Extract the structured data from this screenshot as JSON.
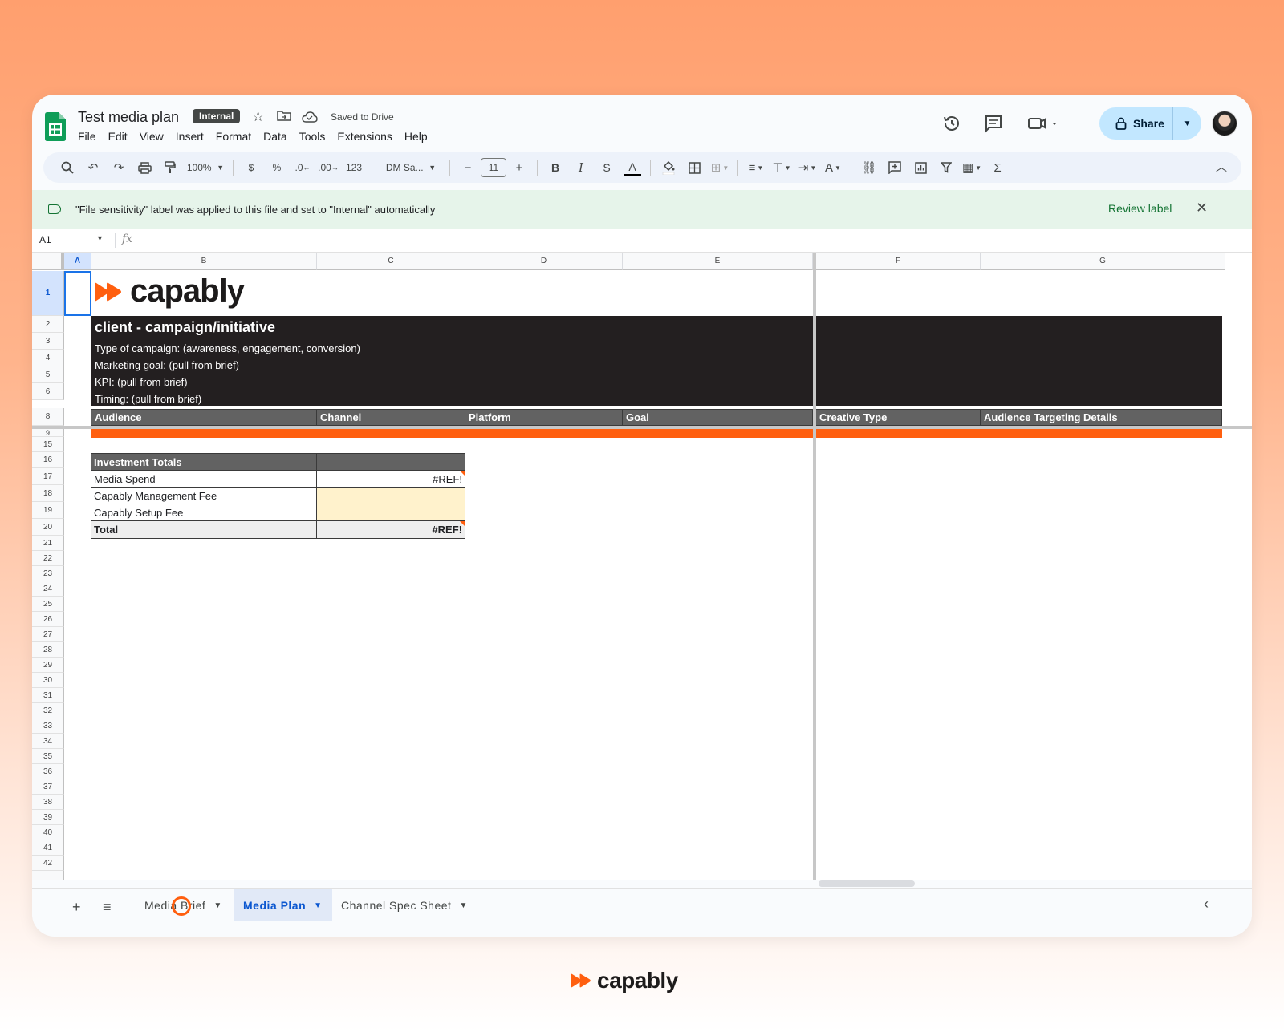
{
  "document": {
    "title": "Test media plan",
    "badge": "Internal",
    "saved_status": "Saved to Drive"
  },
  "menu": [
    "File",
    "Edit",
    "View",
    "Insert",
    "Format",
    "Data",
    "Tools",
    "Extensions",
    "Help"
  ],
  "header_actions": {
    "share_label": "Share",
    "history_icon": "history-icon",
    "comments_icon": "comments-icon",
    "meet_icon": "video-call-icon"
  },
  "toolbar": {
    "zoom": "100%",
    "currency": "$",
    "percent": "%",
    "decrease_decimal": ".0",
    "increase_decimal": ".00",
    "number_format": "123",
    "font": "DM Sa...",
    "font_size": "11",
    "bold": "B",
    "italic": "I",
    "text_color": "A",
    "functions": "Σ"
  },
  "banner": {
    "message": "\"File sensitivity\" label was applied to this file and set to \"Internal\" automatically",
    "link": "Review label"
  },
  "formula_bar": {
    "cell_ref": "A1",
    "fx": "fx"
  },
  "columns": [
    "A",
    "B",
    "C",
    "D",
    "E",
    "F",
    "G"
  ],
  "rows": [
    "1",
    "2",
    "3",
    "4",
    "5",
    "6",
    "8",
    "9",
    "15",
    "16",
    "17",
    "18",
    "19",
    "20",
    "21",
    "22",
    "23",
    "24",
    "25",
    "26",
    "27",
    "28",
    "29",
    "30",
    "31",
    "32",
    "33",
    "34",
    "35",
    "36",
    "37",
    "38",
    "39",
    "40",
    "41",
    "42"
  ],
  "sheet": {
    "logo_text": "capably",
    "heading": "client - campaign/initiative",
    "lines": [
      "Type of campaign: (awareness, engagement, conversion)",
      "Marketing goal: (pull from brief)",
      "KPI: (pull from brief)",
      "Timing: (pull from brief)"
    ],
    "table_headers": [
      "Audience",
      "Channel",
      "Platform",
      "Goal",
      "Creative Type",
      "Audience Targeting Details"
    ],
    "investment": {
      "title": "Investment Totals",
      "rows": [
        {
          "label": "Media Spend",
          "value": "#REF!"
        },
        {
          "label": "Capably Management Fee",
          "value": ""
        },
        {
          "label": "Capably Setup Fee",
          "value": ""
        },
        {
          "label": "Total",
          "value": "#REF!"
        }
      ]
    }
  },
  "tabs": {
    "items": [
      {
        "label": "Media Brief",
        "active": false
      },
      {
        "label": "Media Plan",
        "active": true
      },
      {
        "label": "Channel Spec Sheet",
        "active": false
      }
    ]
  },
  "footer": {
    "logo_text": "capably"
  },
  "colors": {
    "brand_orange": "#ff5f0f",
    "dark_block": "#231f20",
    "header_gray": "#626262",
    "share_blue": "#c2e7ff",
    "banner_green": "#e6f4ea"
  }
}
